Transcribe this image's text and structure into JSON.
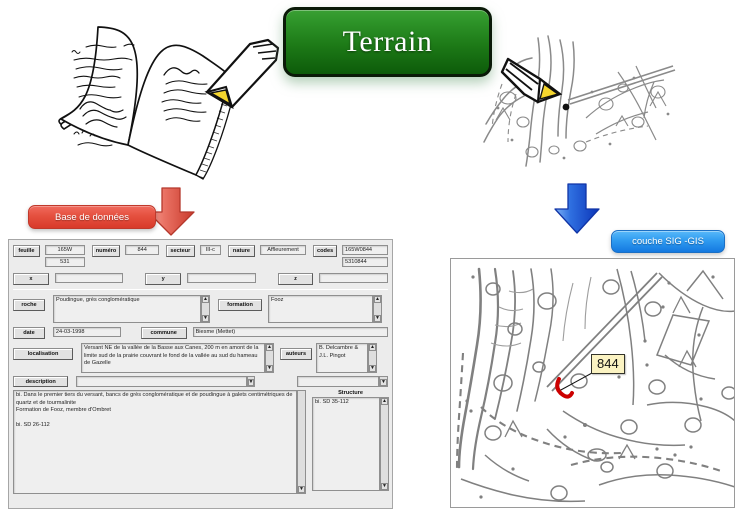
{
  "banner": {
    "title": "Terrain"
  },
  "labels": {
    "database_pill": "Base de données",
    "gis_pill": "couche SIG -GIS"
  },
  "icons": {
    "notebook": "notebook-pencil-icon",
    "sketch_map": "sketch-map-pencil-icon",
    "red_arrow": "arrow-down-red-icon",
    "blue_arrow": "arrow-down-blue-icon"
  },
  "gis_map": {
    "point_label": "844",
    "colors": {
      "contour": "#808080",
      "outcrop": "#cc0000",
      "callout_bg": "#fbf3c2"
    }
  },
  "form": {
    "row_identification": [
      {
        "label": "feuille",
        "value": "165W",
        "value2": "531"
      },
      {
        "label": "numéro",
        "value": "844"
      },
      {
        "label": "secteur",
        "value": "III-c"
      },
      {
        "label": "nature",
        "value": "Affleurement"
      },
      {
        "label": "codes",
        "value": "165W0844",
        "value2": "5310844"
      }
    ],
    "row_coordinates": [
      {
        "label": "x",
        "value": ""
      },
      {
        "label": "y",
        "value": ""
      },
      {
        "label": "z",
        "value": ""
      }
    ],
    "roche": {
      "label": "roche",
      "value": "Poudingue, grès conglomératique"
    },
    "formation": {
      "label": "formation",
      "value": "Fooz"
    },
    "date": {
      "label": "date",
      "value": "24-03-1998"
    },
    "commune": {
      "label": "commune",
      "value": "Biesme (Mettet)"
    },
    "localisation": {
      "label": "localisation",
      "value": "Versant NE de la vallée de la Basse aux Canes, 200 m en amont de la limite sud de la prairie couvrant le fond de la vallée au sud du hameau de Gazelle"
    },
    "auteurs": {
      "label": "auteurs",
      "value": "B. Delcambre & J.L. Pingot"
    },
    "description": {
      "label": "description",
      "value": "bi. Dans le premier tiers du versant, bancs de grès conglomératique et de poudingue à galets centimétriques de quartz et de tourmalinite\nFormation de Fooz, membre d'Ombret\n\nbi. SD 26-112"
    },
    "structure": {
      "label": "Structure",
      "value": "bi. SD 35-112"
    },
    "scroll_up_glyph": "▲",
    "scroll_down_glyph": "▼"
  }
}
